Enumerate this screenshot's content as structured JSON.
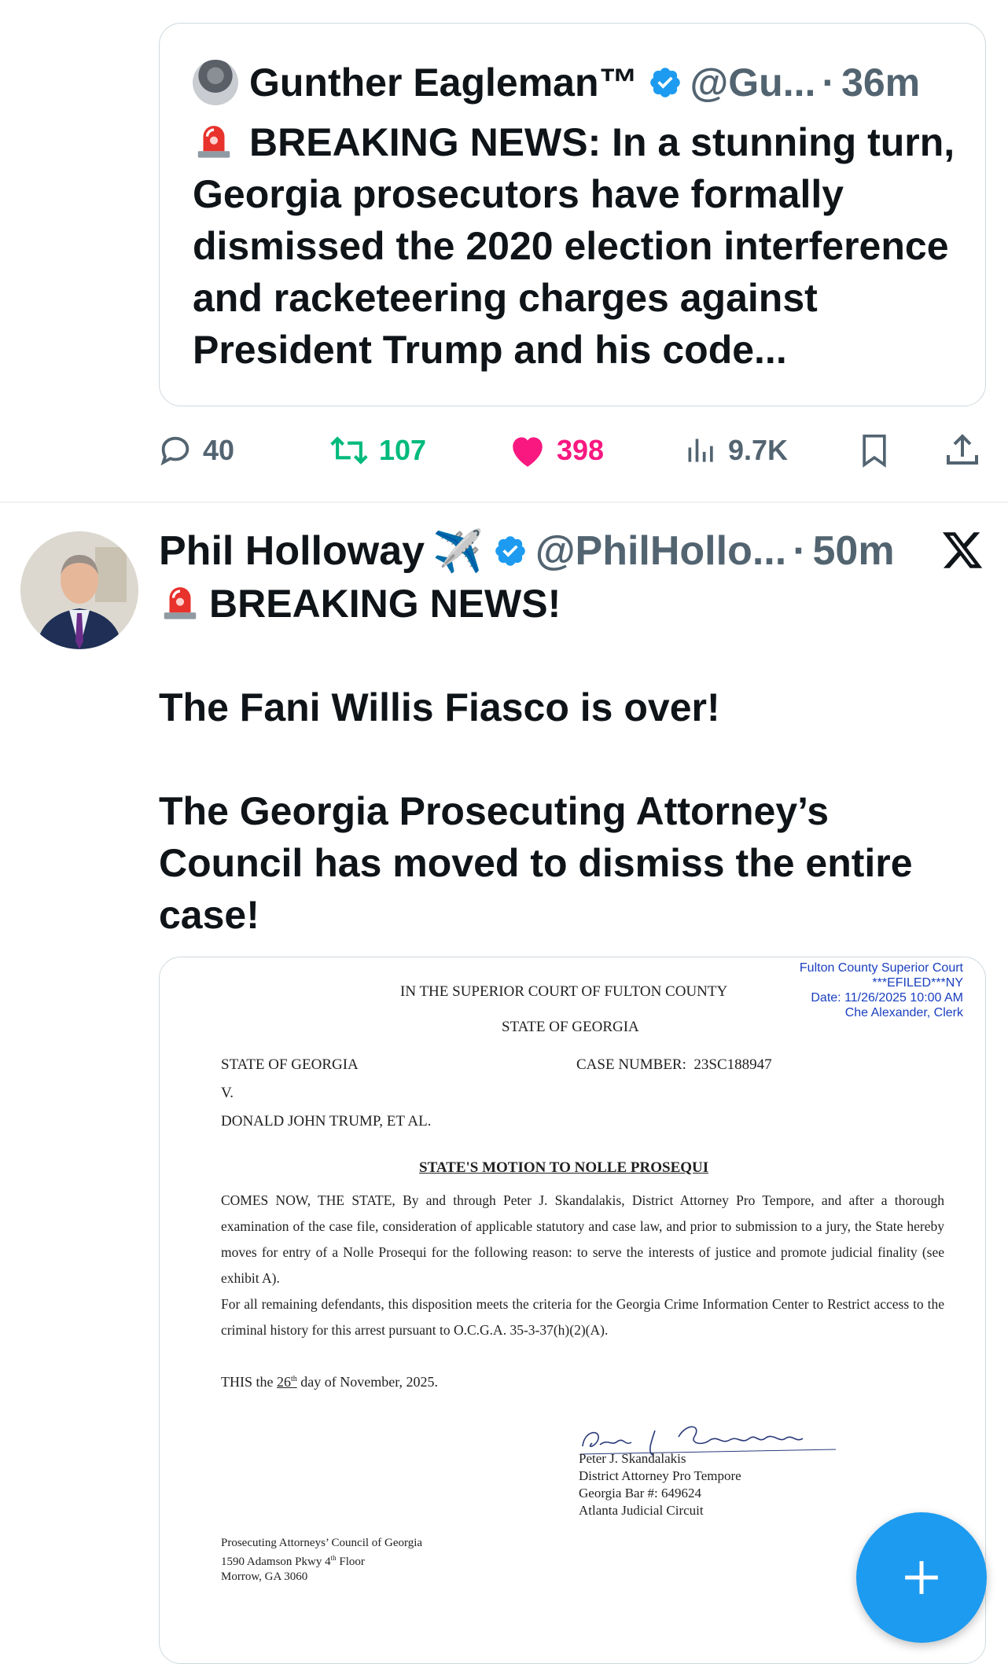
{
  "quoted_tweet": {
    "name": "Gunther Eagleman™",
    "handle": "@Gu...",
    "dot": "·",
    "time": "36m",
    "text": "BREAKING NEWS: In a stunning turn, Georgia prosecutors have formally dismissed the 2020 election interference and racketeering charges against President Trump and his code..."
  },
  "actions": {
    "reply_count": "40",
    "retweet_count": "107",
    "like_count": "398",
    "views_count": "9.7K"
  },
  "tweet": {
    "name": "Phil Holloway",
    "emoji": "✈️",
    "handle": "@PhilHollo...",
    "dot": "·",
    "time": "50m",
    "line1": "BREAKING NEWS!",
    "line2": "The Fani Willis Fiasco is over!",
    "line3": "The Georgia Prosecuting Attorney’s Council has moved to dismiss the entire case!"
  },
  "document": {
    "efile_court": "Fulton County Superior Court",
    "efile_status": "***EFILED***NY",
    "efile_date": "Date: 11/26/2025 10:00 AM",
    "efile_clerk": "Che Alexander, Clerk",
    "court": "IN THE SUPERIOR COURT OF FULTON COUNTY",
    "state": "STATE OF GEORGIA",
    "plaintiff": "STATE OF GEORGIA",
    "case_label": "CASE NUMBER:",
    "case_number": "23SC188947",
    "versus": "V.",
    "defendant": "DONALD JOHN TRUMP, ET AL.",
    "motion_title": "STATE'S MOTION TO NOLLE PROSEQUI",
    "para1": "COMES NOW, THE STATE, By and through Peter J. Skandalakis, District Attorney Pro Tempore, and after a thorough examination of the case file, consideration of applicable statutory and case law, and prior to submission to a jury, the State hereby moves for entry of a Nolle Prosequi for the following reason: to serve the interests of justice and promote judicial finality (see exhibit A).",
    "para2": "For all remaining defendants, this disposition meets the criteria for the Georgia Crime Information Center to Restrict access to the criminal history for this arrest pursuant to O.C.G.A. 35-3-37(h)(2)(A).",
    "date_prefix": "THIS the",
    "date_day": "26",
    "date_sup": "th",
    "date_suffix": "day of November, 2025.",
    "sig_name": "Peter J. Skandalakis",
    "sig_title": "District Attorney Pro Tempore",
    "sig_bar": "Georgia Bar #: 649624",
    "sig_circuit": "Atlanta Judicial Circuit",
    "footer_org": "Prosecuting Attorneys’ Council of Georgia",
    "footer_addr_a": "1590 Adamson Pkwy 4",
    "footer_addr_sup": "th",
    "footer_addr_b": "Floor",
    "footer_city": "Morrow, GA 3060"
  },
  "colors": {
    "accent": "#1d9bf0",
    "like": "#f91880",
    "retweet": "#00ba7c",
    "secondary": "#536471"
  }
}
